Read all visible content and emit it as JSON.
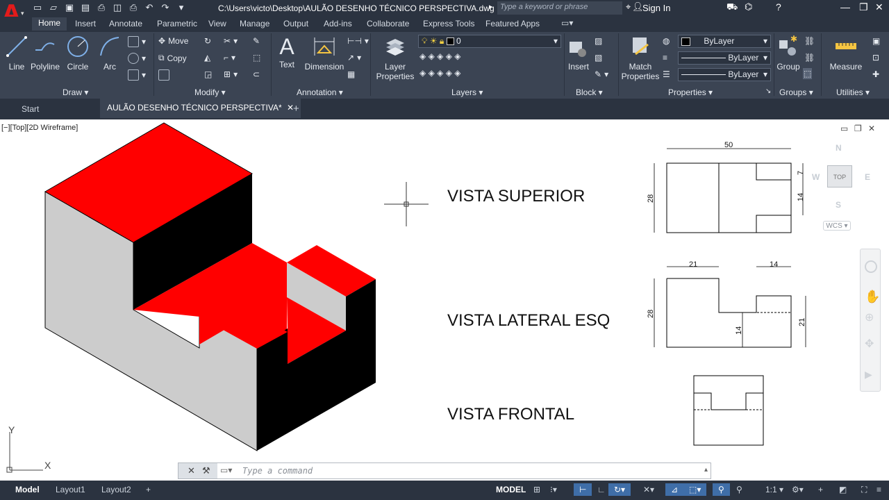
{
  "titlebar": {
    "file_path": "C:\\Users\\victo\\Desktop\\AULÃO DESENHO TÉCNICO PERSPECTIVA.dwg",
    "search_placeholder": "Type a keyword or phrase",
    "sign_in": "Sign In"
  },
  "ribbon_tabs": [
    "Home",
    "Insert",
    "Annotate",
    "Parametric",
    "View",
    "Manage",
    "Output",
    "Add-ins",
    "Collaborate",
    "Express Tools",
    "Featured Apps"
  ],
  "ribbon": {
    "draw": {
      "title": "Draw",
      "line": "Line",
      "polyline": "Polyline",
      "circle": "Circle",
      "arc": "Arc"
    },
    "modify": {
      "title": "Modify",
      "move": "Move",
      "copy": "Copy"
    },
    "annotation": {
      "title": "Annotation",
      "text": "Text",
      "dimension": "Dimension"
    },
    "layers": {
      "title": "Layers",
      "layer_properties_1": "Layer",
      "layer_properties_2": "Properties",
      "current_layer": "0"
    },
    "block": {
      "title": "Block",
      "insert": "Insert"
    },
    "properties": {
      "title": "Properties",
      "match_1": "Match",
      "match_2": "Properties",
      "color": "ByLayer",
      "linetype": "ByLayer",
      "lineweight": "ByLayer"
    },
    "groups": {
      "title": "Groups",
      "group": "Group"
    },
    "utilities": {
      "title": "Utilities",
      "measure": "Measure"
    }
  },
  "doc_tabs": {
    "start": "Start",
    "active": "AULÃO DESENHO TÉCNICO PERSPECTIVA*"
  },
  "viewport": {
    "label": "[−][Top][2D Wireframe]"
  },
  "viewcube": {
    "n": "N",
    "s": "S",
    "e": "E",
    "w": "W",
    "face": "TOP",
    "wcs": "WCS"
  },
  "drawing": {
    "vista_superior": "VISTA SUPERIOR",
    "vista_lateral": "VISTA LATERAL ESQ",
    "vista_frontal": "VISTA FRONTAL",
    "dims": {
      "d50": "50",
      "d28a": "28",
      "d7": "7",
      "d14a": "14",
      "d21a": "21",
      "d14b": "14",
      "d28b": "28",
      "d14c": "14",
      "d21b": "21"
    }
  },
  "ucs": {
    "x": "X",
    "y": "Y"
  },
  "command": {
    "placeholder": "Type a command"
  },
  "layout_tabs": {
    "model": "Model",
    "layout1": "Layout1",
    "layout2": "Layout2"
  },
  "statusbar": {
    "model": "MODEL",
    "scale": "1:1"
  },
  "colors": {
    "red": "#ff0000",
    "gray": "#cccccc",
    "black": "#000000",
    "ribbon": "#3b4453",
    "titlebar": "#2b3340"
  }
}
